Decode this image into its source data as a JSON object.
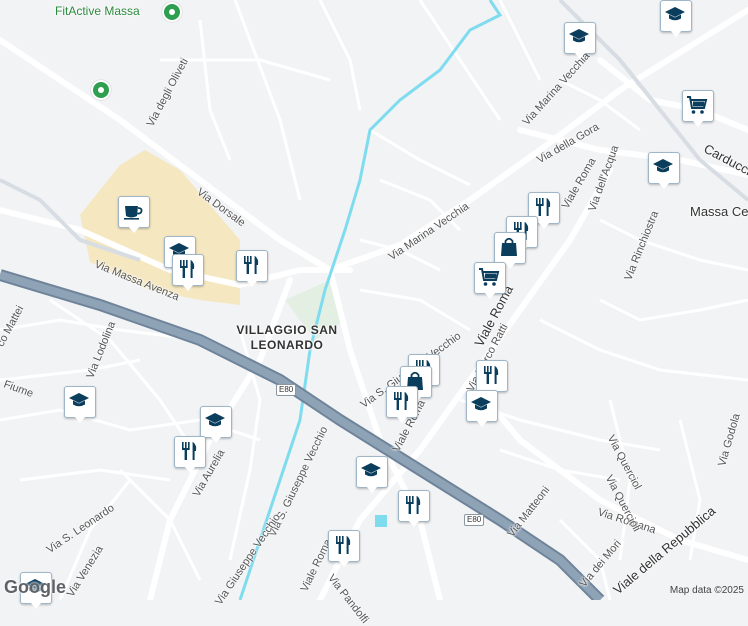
{
  "map": {
    "attribution": "Map data ©2025",
    "logo": "Google",
    "colors": {
      "background": "#f2f3f5",
      "road": "#ffffff",
      "highway": "#8b9fb3",
      "water": "#7fdcef",
      "marker_icon": "#0b3d5c",
      "poi_green": "#2e9e4f",
      "sand": "#f5e7c0"
    },
    "place_labels": [
      {
        "text": "FitActive Massa"
      },
      {
        "text": "VILLAGGIO SAN LEONARDO"
      },
      {
        "text": "Massa Centro"
      }
    ],
    "road_labels": [
      "Via degli Oliveti",
      "Via Dorsale",
      "Via Massa Avenza",
      "Via Marina Vecchia",
      "Via Marina Vecchia",
      "Via della Gora",
      "Viale Roma",
      "Via dell'Acqua",
      "Via Rinchiostra",
      "Carducci",
      "Viale Roma",
      "Via S. Giuseppe Vecchio",
      "Via Marco Ratti",
      "Via Lodolina",
      "co Mattei",
      "Fiume",
      "Via S. Leonardo",
      "Via Venezia",
      "Via Aurelia",
      "Via S. Giuseppe Vecchio",
      "Via Querciol",
      "Via Godola",
      "Via Romana",
      "Viale della Repubblica",
      "Via dei Mori",
      "Via Matteoni",
      "Viale Roma",
      "Via Pandolfi",
      "Viale Roma",
      "Via Giuseppe Vecchio",
      "Via Quercioli"
    ],
    "highway_shields": [
      "E80",
      "E80"
    ],
    "markers": [
      {
        "icon": "graduation-cap-icon"
      },
      {
        "icon": "graduation-cap-icon"
      },
      {
        "icon": "shopping-cart-icon"
      },
      {
        "icon": "graduation-cap-icon"
      },
      {
        "icon": "coffee-cup-icon"
      },
      {
        "icon": "graduation-cap-icon"
      },
      {
        "icon": "restaurant-icon"
      },
      {
        "icon": "restaurant-icon"
      },
      {
        "icon": "restaurant-icon"
      },
      {
        "icon": "restaurant-icon"
      },
      {
        "icon": "shopping-bag-icon"
      },
      {
        "icon": "shopping-cart-icon"
      },
      {
        "icon": "restaurant-icon"
      },
      {
        "icon": "shopping-bag-icon"
      },
      {
        "icon": "restaurant-icon"
      },
      {
        "icon": "restaurant-icon"
      },
      {
        "icon": "graduation-cap-icon"
      },
      {
        "icon": "graduation-cap-icon"
      },
      {
        "icon": "graduation-cap-icon"
      },
      {
        "icon": "restaurant-icon"
      },
      {
        "icon": "graduation-cap-icon"
      },
      {
        "icon": "restaurant-icon"
      },
      {
        "icon": "restaurant-icon"
      },
      {
        "icon": "graduation-cap-icon"
      }
    ]
  }
}
